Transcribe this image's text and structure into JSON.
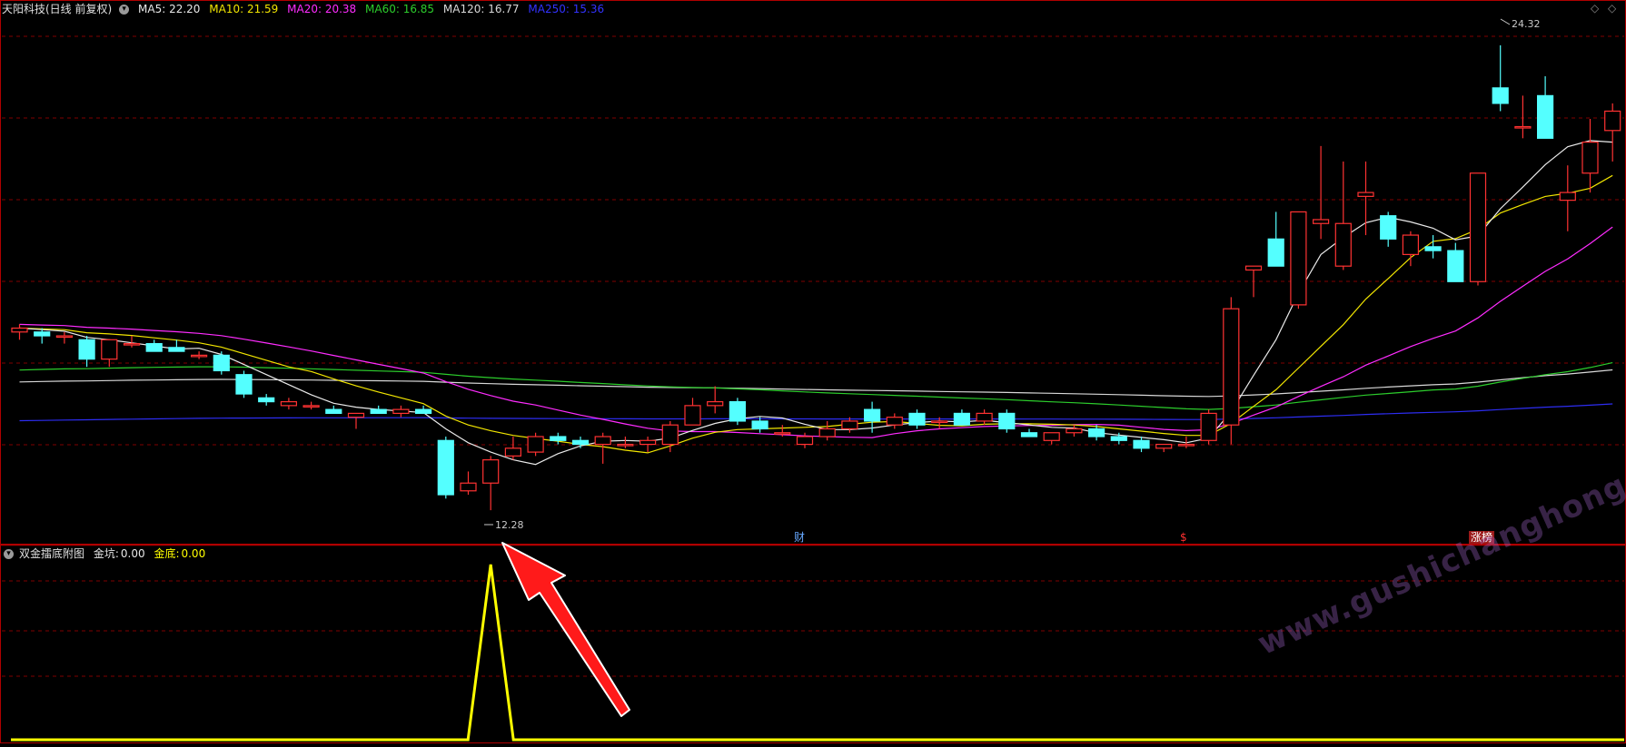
{
  "main_header": {
    "title": "天阳科技(日线 前复权)",
    "ma": [
      {
        "label": "MA5: 22.20",
        "color": "#e8e8e8"
      },
      {
        "label": "MA10: 21.59",
        "color": "#f2e600"
      },
      {
        "label": "MA20: 20.38",
        "color": "#ff2cff"
      },
      {
        "label": "MA60: 16.85",
        "color": "#2ccd2c"
      },
      {
        "label": "MA120: 16.77",
        "color": "#d8d8d8"
      },
      {
        "label": "MA250: 15.36",
        "color": "#2d2df2"
      }
    ]
  },
  "price_labels": {
    "high": "24.32",
    "low": "12.28"
  },
  "event_tags": {
    "cai": "财",
    "dollar": "$",
    "zhangbang": "涨榜"
  },
  "sub_header": {
    "title": "双金擂底附图",
    "jinkeng_label": "金坑:",
    "jinkeng_value": "0.00",
    "jindi_label": "金底:",
    "jindi_value": "0.00"
  },
  "watermark": "www.gushichanghong.com",
  "colors": {
    "up": "#ff3232",
    "down": "#54ffff",
    "border": "#b00000",
    "grid": "#800000",
    "arrow": "#ff1a1a",
    "signal": "#ffff00"
  },
  "chart_data": {
    "type": "candlestick",
    "ylim": [
      11.6,
      25.0
    ],
    "candles": [
      [
        16.9,
        17.1,
        16.7,
        17.0
      ],
      [
        16.9,
        17.0,
        16.6,
        16.8
      ],
      [
        16.8,
        16.9,
        16.6,
        16.8
      ],
      [
        16.7,
        16.8,
        16.0,
        16.2
      ],
      [
        16.2,
        16.7,
        16.0,
        16.7
      ],
      [
        16.6,
        16.8,
        16.5,
        16.6
      ],
      [
        16.6,
        16.7,
        16.4,
        16.4
      ],
      [
        16.5,
        16.7,
        16.4,
        16.4
      ],
      [
        16.3,
        16.4,
        16.2,
        16.3
      ],
      [
        16.3,
        16.4,
        15.8,
        15.9
      ],
      [
        15.8,
        15.9,
        15.2,
        15.3
      ],
      [
        15.2,
        15.3,
        15.0,
        15.1
      ],
      [
        15.0,
        15.2,
        14.9,
        15.1
      ],
      [
        15.0,
        15.1,
        14.9,
        15.0
      ],
      [
        14.9,
        15.0,
        14.8,
        14.8
      ],
      [
        14.7,
        14.8,
        14.4,
        14.8
      ],
      [
        14.9,
        15.0,
        14.8,
        14.8
      ],
      [
        14.8,
        15.0,
        14.7,
        14.9
      ],
      [
        14.9,
        15.0,
        14.8,
        14.8
      ],
      [
        14.1,
        14.2,
        12.6,
        12.7
      ],
      [
        12.8,
        13.3,
        12.7,
        13.0
      ],
      [
        13.0,
        13.7,
        12.3,
        13.6
      ],
      [
        13.7,
        14.2,
        13.6,
        13.9
      ],
      [
        13.8,
        14.3,
        13.7,
        14.2
      ],
      [
        14.2,
        14.3,
        14.0,
        14.1
      ],
      [
        14.1,
        14.2,
        13.9,
        14.0
      ],
      [
        14.0,
        14.3,
        13.5,
        14.2
      ],
      [
        14.0,
        14.2,
        13.9,
        14.0
      ],
      [
        14.0,
        14.2,
        13.8,
        14.1
      ],
      [
        14.0,
        14.6,
        13.8,
        14.5
      ],
      [
        14.5,
        15.2,
        14.5,
        15.0
      ],
      [
        15.0,
        15.5,
        14.8,
        15.1
      ],
      [
        15.1,
        15.2,
        14.5,
        14.6
      ],
      [
        14.6,
        14.7,
        14.3,
        14.4
      ],
      [
        14.3,
        14.5,
        14.2,
        14.3
      ],
      [
        14.0,
        14.3,
        13.9,
        14.2
      ],
      [
        14.2,
        14.6,
        14.1,
        14.4
      ],
      [
        14.4,
        14.7,
        14.3,
        14.6
      ],
      [
        14.9,
        15.1,
        14.3,
        14.6
      ],
      [
        14.5,
        14.8,
        14.4,
        14.7
      ],
      [
        14.8,
        14.9,
        14.4,
        14.5
      ],
      [
        14.6,
        14.7,
        14.4,
        14.6
      ],
      [
        14.8,
        14.9,
        14.5,
        14.5
      ],
      [
        14.6,
        14.9,
        14.5,
        14.8
      ],
      [
        14.8,
        14.9,
        14.3,
        14.4
      ],
      [
        14.3,
        14.4,
        14.2,
        14.2
      ],
      [
        14.1,
        14.3,
        14.0,
        14.3
      ],
      [
        14.3,
        14.5,
        14.2,
        14.4
      ],
      [
        14.4,
        14.5,
        14.1,
        14.2
      ],
      [
        14.2,
        14.3,
        14.0,
        14.1
      ],
      [
        14.1,
        14.2,
        13.8,
        13.9
      ],
      [
        13.9,
        14.0,
        13.8,
        14.0
      ],
      [
        14.0,
        14.2,
        13.9,
        14.0
      ],
      [
        14.1,
        14.9,
        14.0,
        14.8
      ],
      [
        14.5,
        17.8,
        14.0,
        17.5
      ],
      [
        18.5,
        18.6,
        17.8,
        18.6
      ],
      [
        19.3,
        20.0,
        18.8,
        18.6
      ],
      [
        17.6,
        19.8,
        17.5,
        20.0
      ],
      [
        19.7,
        21.7,
        19.3,
        19.8
      ],
      [
        18.6,
        21.3,
        18.5,
        19.7
      ],
      [
        20.4,
        21.3,
        19.4,
        20.5
      ],
      [
        19.9,
        20.0,
        19.1,
        19.3
      ],
      [
        18.9,
        19.5,
        18.6,
        19.4
      ],
      [
        19.1,
        19.4,
        18.8,
        19.0
      ],
      [
        19.0,
        19.2,
        18.2,
        18.2
      ],
      [
        18.2,
        21.0,
        18.1,
        21.0
      ],
      [
        23.2,
        24.3,
        22.6,
        22.8
      ],
      [
        22.2,
        23.0,
        21.9,
        22.2
      ],
      [
        23.0,
        23.5,
        21.9,
        21.9
      ],
      [
        20.3,
        21.2,
        19.5,
        20.5
      ],
      [
        21.0,
        22.4,
        20.5,
        21.8
      ],
      [
        22.1,
        22.8,
        21.3,
        22.6
      ]
    ]
  }
}
